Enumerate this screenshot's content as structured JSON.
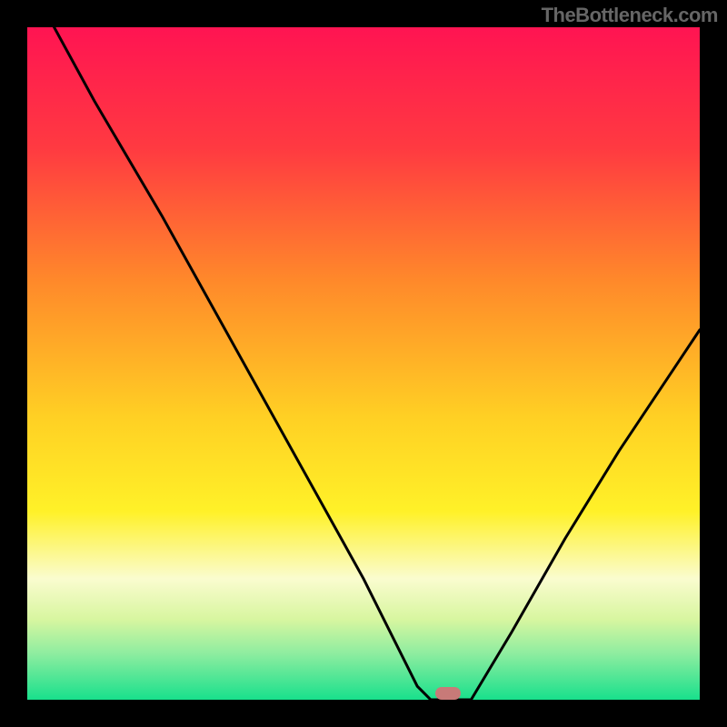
{
  "attribution": "TheBottleneck.com",
  "gradient_stops": [
    {
      "offset": "0%",
      "color": "#ff1452"
    },
    {
      "offset": "18%",
      "color": "#ff3a41"
    },
    {
      "offset": "38%",
      "color": "#ff8a2a"
    },
    {
      "offset": "58%",
      "color": "#ffd024"
    },
    {
      "offset": "72%",
      "color": "#fff128"
    },
    {
      "offset": "82%",
      "color": "#fafccf"
    },
    {
      "offset": "88%",
      "color": "#d8f6a0"
    },
    {
      "offset": "93%",
      "color": "#90eda0"
    },
    {
      "offset": "100%",
      "color": "#18e08c"
    }
  ],
  "marker": {
    "color": "#c87a78",
    "x_pct": 62.5,
    "y_pct": 99.0
  },
  "chart_data": {
    "type": "line",
    "title": "",
    "xlabel": "",
    "ylabel": "",
    "xlim": [
      0,
      100
    ],
    "ylim": [
      0,
      100
    ],
    "series": [
      {
        "name": "left-segment",
        "x": [
          4.0,
          10,
          20,
          30,
          40,
          50,
          55,
          58,
          60
        ],
        "values": [
          100,
          89,
          72,
          54,
          36,
          18,
          8,
          2,
          0
        ]
      },
      {
        "name": "flat-segment",
        "x": [
          60,
          66
        ],
        "values": [
          0,
          0
        ]
      },
      {
        "name": "right-segment",
        "x": [
          66,
          72,
          80,
          88,
          96,
          100
        ],
        "values": [
          0,
          10,
          24,
          37,
          49,
          55
        ]
      }
    ],
    "marker_point": {
      "x": 62.5,
      "y": 0
    }
  }
}
